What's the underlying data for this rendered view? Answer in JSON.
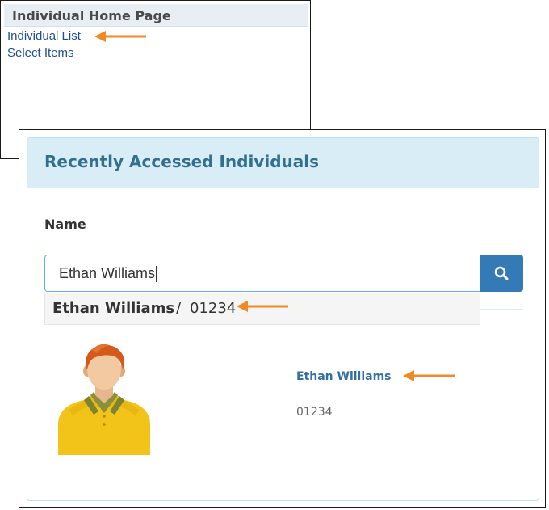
{
  "back_panel": {
    "title": "Individual Home Page",
    "links": [
      "Individual List",
      "Select Items"
    ]
  },
  "card": {
    "title": "Recently Accessed Individuals",
    "name_label": "Name",
    "search_value": "Ethan Williams",
    "suggestion": {
      "name": "Ethan Williams",
      "separator": "/",
      "id": "01234"
    },
    "person": {
      "name": "Ethan Williams",
      "id": "01234"
    }
  },
  "colors": {
    "annotation_arrow": "#f08a24",
    "header_bg": "#d9edf7",
    "header_text": "#31708f",
    "button_bg": "#337ab7",
    "link_text": "#1f4e8f"
  },
  "icons": [
    "search-icon",
    "person-avatar",
    "arrow-left-icon"
  ]
}
